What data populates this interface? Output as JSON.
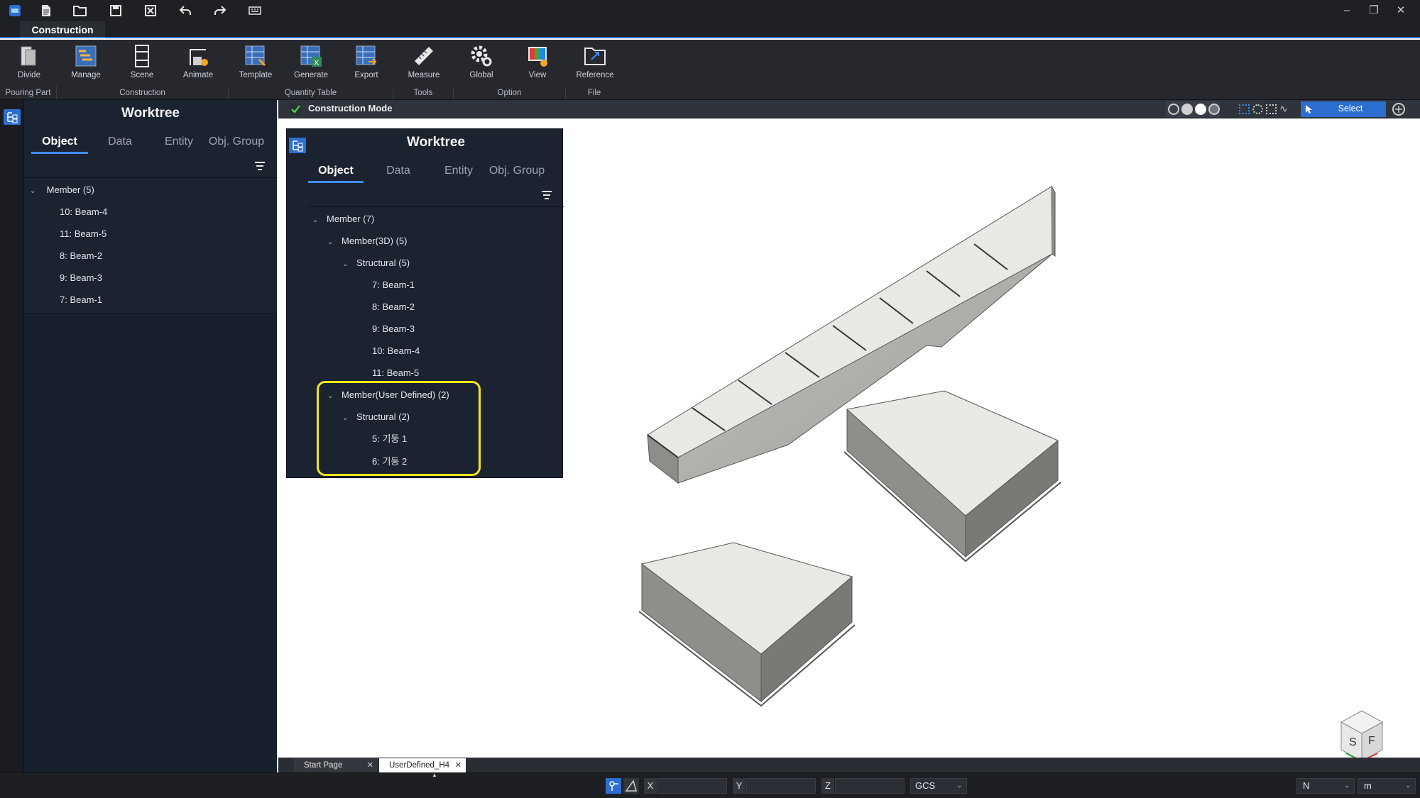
{
  "ribbon": {
    "tab": "Construction",
    "buttons": {
      "divide": "Divide",
      "manage": "Manage",
      "scene": "Scene",
      "animate": "Animate",
      "template": "Template",
      "generate": "Generate",
      "export": "Export",
      "measure": "Measure",
      "global": "Global",
      "view": "View",
      "reference": "Reference"
    },
    "groups": {
      "pouring": "Pouring Part",
      "construction": "Construction",
      "quantity": "Quantity Table",
      "tools": "Tools",
      "option": "Option",
      "file": "File"
    }
  },
  "left_panel": {
    "title": "Worktree",
    "tabs": [
      "Object",
      "Data",
      "Entity",
      "Obj. Group"
    ],
    "tree": {
      "root": "Member (5)",
      "items": [
        "10: Beam-4",
        "11: Beam-5",
        "8: Beam-2",
        "9: Beam-3",
        "7: Beam-1"
      ]
    }
  },
  "viewport": {
    "mode_label": "Construction Mode",
    "select_label": "Select"
  },
  "inner_panel": {
    "title": "Worktree",
    "tabs": [
      "Object",
      "Data",
      "Entity",
      "Obj. Group"
    ],
    "tree": {
      "root": "Member (7)",
      "member3d": "Member(3D) (5)",
      "structural_a": "Structural (5)",
      "beams": [
        "7: Beam-1",
        "8: Beam-2",
        "9: Beam-3",
        "10: Beam-4",
        "11: Beam-5"
      ],
      "user_defined": "Member(User Defined) (2)",
      "structural_b": "Structural (2)",
      "columns": [
        "5: 기둥 1",
        "6: 기둥 2"
      ]
    },
    "highlight_color": "#f5e614"
  },
  "doc_tabs": [
    "Start Page",
    "UserDefined_H4"
  ],
  "statusbar": {
    "x_label": "X",
    "y_label": "Y",
    "z_label": "Z",
    "coord_system": "GCS",
    "force_unit": "N",
    "length_unit": "m"
  },
  "view_cube": {
    "faces": [
      "S",
      "F"
    ]
  },
  "colors": {
    "accent": "#3f8cff",
    "panel_bg": "#1b2330",
    "check_green": "#4cc94c"
  }
}
